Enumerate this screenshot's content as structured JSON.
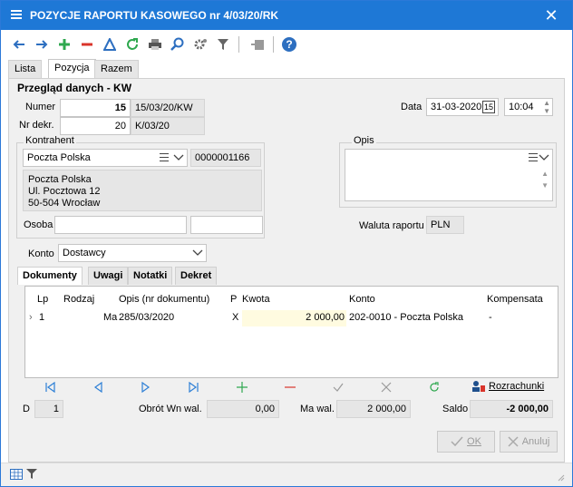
{
  "window": {
    "title": "POZYCJE RAPORTU KASOWEGO nr 4/03/20/RK",
    "close_glyph": "✕"
  },
  "tabs": [
    "Lista",
    "Pozycja",
    "Razem"
  ],
  "section_title": "Przegląd danych - KW",
  "numer": {
    "label": "Numer",
    "value": "15",
    "symbol": "15/03/20/KW"
  },
  "nr_dekr": {
    "label": "Nr dekr.",
    "value": "20",
    "symbol": "K/03/20"
  },
  "data": {
    "label": "Data",
    "date": "31-03-2020",
    "time": "10:04",
    "cal_glyph": "15"
  },
  "kontrahent": {
    "title": "Kontrahent",
    "name": "Poczta Polska",
    "code": "0000001166",
    "address": [
      "Poczta Polska",
      "Ul. Pocztowa 12",
      "50-504 Wrocław"
    ],
    "osoba_label": "Osoba"
  },
  "opis": {
    "title": "Opis"
  },
  "waluta": {
    "label": "Waluta raportu",
    "value": "PLN"
  },
  "konto": {
    "label": "Konto",
    "value": "Dostawcy"
  },
  "subtabs": [
    "Dokumenty",
    "Uwagi",
    "Notatki",
    "Dekret"
  ],
  "grid": {
    "headers": [
      "Lp",
      "Rodzaj",
      "Opis (nr dokumentu)",
      "P",
      "Kwota",
      "Konto",
      "Kompensata"
    ],
    "row": {
      "lp": "1",
      "rodzaj": "Ma",
      "opis": "285/03/2020",
      "p": "X",
      "kwota": "2 000,00",
      "konto": "202-0010 - Poczta Polska",
      "kompensata": "-"
    }
  },
  "rozrachunki": "Rozrachunki",
  "footer": {
    "d_label": "D",
    "d_value": "1",
    "obrot_label": "Obrót Wn wal.",
    "obrot_value": "0,00",
    "ma_label": "Ma wal.",
    "ma_value": "2 000,00",
    "saldo_label": "Saldo",
    "saldo_value": "-2 000,00"
  },
  "buttons": {
    "ok": "OK",
    "anuluj": "Anuluj"
  },
  "colors": {
    "titlebar": "#1e78d6",
    "accent_green": "#2fa84f",
    "accent_red": "#d9342b",
    "nav_blue": "#2d7fd6",
    "kwota_bg": "#fffbe0"
  }
}
